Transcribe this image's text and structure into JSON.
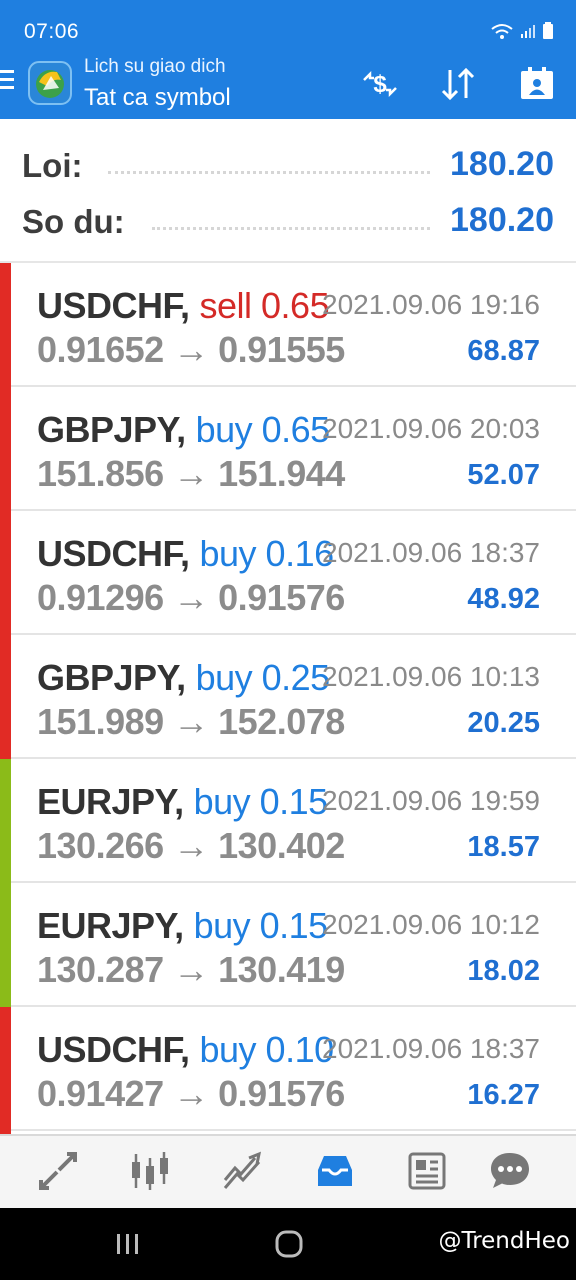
{
  "status_bar": {
    "time": "07:06"
  },
  "header": {
    "subtitle": "Lich su giao dich",
    "title": "Tat ca symbol",
    "icons": [
      "menu-icon",
      "app-logo-icon",
      "deposit-withdraw-icon",
      "sort-icon",
      "report-icon"
    ]
  },
  "summary": {
    "profit_label": "Loi:",
    "profit_value": "180.20",
    "balance_label": "So du:",
    "balance_value": "180.20"
  },
  "trades": [
    {
      "symbol": "USDCHF,",
      "type": "sell 0.65",
      "side": "sell",
      "time": "2021.09.06 19:16",
      "prices": "0.91652 → 0.91555",
      "profit": "68.87",
      "bar_color": "#e12b25"
    },
    {
      "symbol": "GBPJPY,",
      "type": "buy 0.65",
      "side": "buy",
      "time": "2021.09.06 20:03",
      "prices": "151.856 → 151.944",
      "profit": "52.07",
      "bar_color": "#e12b25"
    },
    {
      "symbol": "USDCHF,",
      "type": "buy 0.16",
      "side": "buy",
      "time": "2021.09.06 18:37",
      "prices": "0.91296 → 0.91576",
      "profit": "48.92",
      "bar_color": "#e12b25"
    },
    {
      "symbol": "GBPJPY,",
      "type": "buy 0.25",
      "side": "buy",
      "time": "2021.09.06 10:13",
      "prices": "151.989 → 152.078",
      "profit": "20.25",
      "bar_color": "#e12b25"
    },
    {
      "symbol": "EURJPY,",
      "type": "buy 0.15",
      "side": "buy",
      "time": "2021.09.06 19:59",
      "prices": "130.266 → 130.402",
      "profit": "18.57",
      "bar_color": "#8bbb19"
    },
    {
      "symbol": "EURJPY,",
      "type": "buy 0.15",
      "side": "buy",
      "time": "2021.09.06 10:12",
      "prices": "130.287 → 130.419",
      "profit": "18.02",
      "bar_color": "#8bbb19"
    },
    {
      "symbol": "USDCHF,",
      "type": "buy 0.10",
      "side": "buy",
      "time": "2021.09.06 18:37",
      "prices": "0.91427 → 0.91576",
      "profit": "16.27",
      "bar_color": "#e12b25"
    }
  ],
  "colors": {
    "accent": "#1f7fe0",
    "buy": "#1f7fe0",
    "sell": "#d42a27",
    "profit": "#1f6fd1"
  },
  "bottom_nav": [
    "quotes-icon",
    "chart-icon",
    "trade-icon",
    "history-icon",
    "news-icon",
    "chat-icon"
  ],
  "watermark": "@TrendHeo"
}
